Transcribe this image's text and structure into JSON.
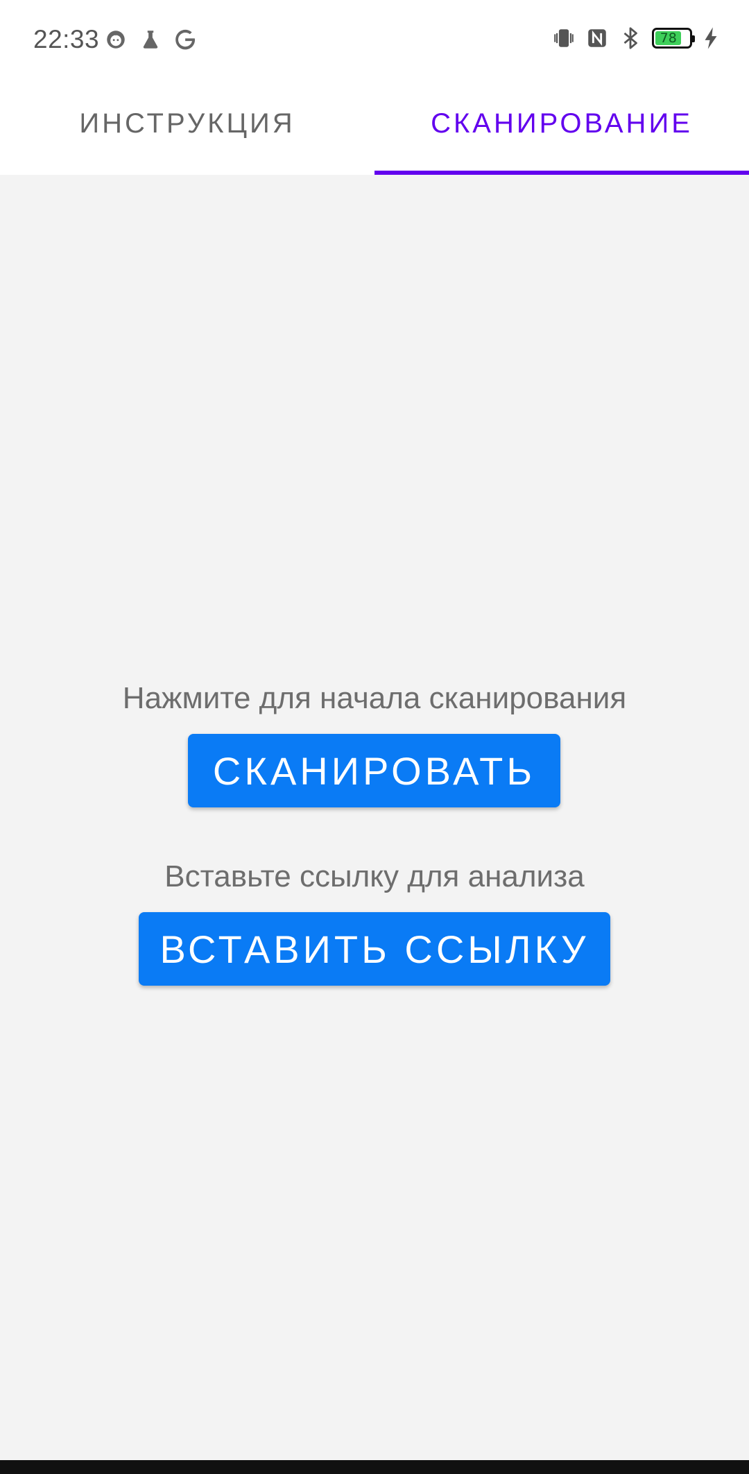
{
  "status_bar": {
    "time": "22:33",
    "left_icons": [
      "face-notification-icon",
      "flask-icon",
      "google-icon"
    ],
    "right_icons": [
      "vibrate-icon",
      "nfc-icon",
      "bluetooth-icon",
      "battery-icon",
      "charging-icon"
    ],
    "battery_level": "78",
    "battery_fraction": 0.78
  },
  "tabs": [
    {
      "label": "ИНСТРУКЦИЯ",
      "active": false
    },
    {
      "label": "СКАНИРОВАНИЕ",
      "active": true
    }
  ],
  "colors": {
    "accent": "#6200ee",
    "button": "#0a7bf5",
    "background": "#f3f3f3",
    "battery_fill": "#3ecf5a"
  },
  "scan": {
    "prompt": "Нажмите для начала сканирования",
    "button_label": "СКАНИРОВАТЬ"
  },
  "link": {
    "prompt": "Вставьте ссылку для анализа",
    "button_label": "ВСТАВИТЬ ССЫЛКУ"
  }
}
